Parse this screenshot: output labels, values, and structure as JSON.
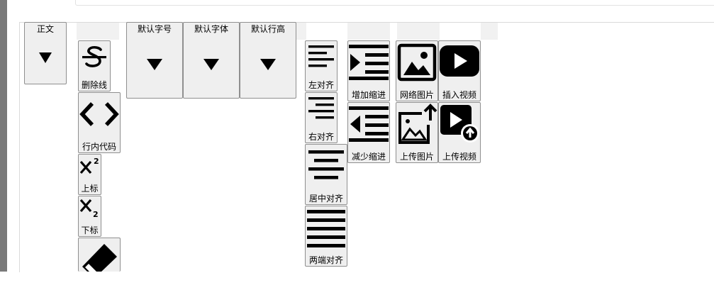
{
  "toolbar": {
    "paragraph_style": "正文",
    "strikethrough": "删除线",
    "inline_code": "行内代码",
    "superscript": "上标",
    "subscript": "下标",
    "font_size": "默认字号",
    "font_family": "默认字体",
    "line_height": "默认行高",
    "align_left": "左对齐",
    "align_right": "右对齐",
    "align_center": "居中对齐",
    "align_justify": "两端对齐",
    "indent": "增加缩进",
    "outdent": "减少缩进",
    "web_image": "网络图片",
    "upload_image": "上传图片",
    "insert_video": "插入视频",
    "upload_video": "上传视频"
  },
  "icons": {
    "strikethrough": "strikethrough-icon",
    "inline_code": "code-icon",
    "superscript": "superscript-icon",
    "subscript": "subscript-icon",
    "clear_format": "eraser-icon",
    "dropdown": "caret-down-icon",
    "align_left": "align-left-icon",
    "align_right": "align-right-icon",
    "align_center": "align-center-icon",
    "align_justify": "align-justify-icon",
    "indent": "indent-icon",
    "outdent": "outdent-icon",
    "image": "image-icon",
    "upload_image": "image-upload-icon",
    "video": "play-icon",
    "upload_video": "video-upload-icon"
  }
}
